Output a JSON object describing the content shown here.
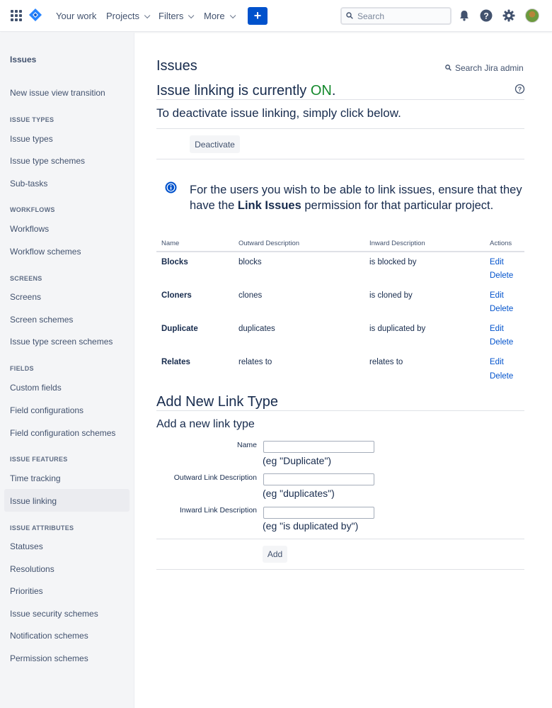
{
  "topnav": {
    "your_work": "Your work",
    "projects": "Projects",
    "filters": "Filters",
    "more": "More",
    "create_label": "+",
    "search_placeholder": "Search",
    "colors": {
      "accent": "#0052cc"
    }
  },
  "sidebar": {
    "title": "Issues",
    "items": {
      "transition": "New issue view transition",
      "issue_types_heading": "ISSUE TYPES",
      "issue_types": "Issue types",
      "issue_type_schemes": "Issue type schemes",
      "sub_tasks": "Sub-tasks",
      "workflows_heading": "WORKFLOWS",
      "workflows": "Workflows",
      "workflow_schemes": "Workflow schemes",
      "screens_heading": "SCREENS",
      "screens": "Screens",
      "screen_schemes": "Screen schemes",
      "issue_type_screen_schemes": "Issue type screen schemes",
      "fields_heading": "FIELDS",
      "custom_fields": "Custom fields",
      "field_configurations": "Field configurations",
      "field_configuration_schemes": "Field configuration schemes",
      "issue_features_heading": "ISSUE FEATURES",
      "time_tracking": "Time tracking",
      "issue_linking": "Issue linking",
      "issue_attributes_heading": "ISSUE ATTRIBUTES",
      "statuses": "Statuses",
      "resolutions": "Resolutions",
      "priorities": "Priorities",
      "issue_security_schemes": "Issue security schemes",
      "notification_schemes": "Notification schemes",
      "permission_schemes": "Permission schemes"
    }
  },
  "main": {
    "page_title": "Issues",
    "admin_search": "Search Jira admin",
    "linking_prefix": "Issue linking is currently ",
    "linking_state": "ON",
    "linking_suffix": ".",
    "deactivate_text": "To deactivate issue linking, simply click below.",
    "deactivate_button": "Deactivate",
    "info_prefix": "For the users you wish to be able to link issues, ensure that they have the ",
    "info_bold": "Link Issues",
    "info_suffix": " permission for that particular project.",
    "table": {
      "headers": [
        "Name",
        "Outward Description",
        "Inward Description",
        "Actions"
      ],
      "rows": [
        {
          "name": "Blocks",
          "outward": "blocks",
          "inward": "is blocked by"
        },
        {
          "name": "Cloners",
          "outward": "clones",
          "inward": "is cloned by"
        },
        {
          "name": "Duplicate",
          "outward": "duplicates",
          "inward": "is duplicated by"
        },
        {
          "name": "Relates",
          "outward": "relates to",
          "inward": "relates to"
        }
      ],
      "edit_label": "Edit",
      "delete_label": "Delete"
    },
    "add": {
      "title": "Add New Link Type",
      "subtitle": "Add a new link type",
      "name_label": "Name",
      "name_hint": "(eg \"Duplicate\")",
      "outward_label": "Outward Link Description",
      "outward_hint": "(eg \"duplicates\")",
      "inward_label": "Inward Link Description",
      "inward_hint": "(eg \"is duplicated by\")",
      "add_button": "Add"
    },
    "colors": {
      "on": "#14892c",
      "link": "#0052cc",
      "text": "#172b4d"
    }
  }
}
